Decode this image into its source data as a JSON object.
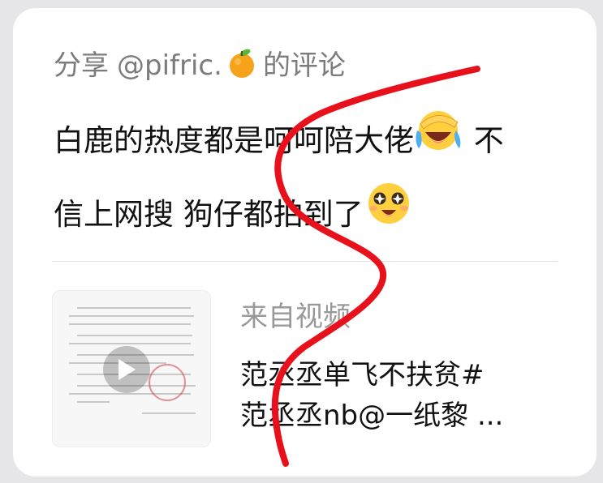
{
  "header": {
    "prefix": "分享",
    "handle": "@pifric.",
    "handle_emoji": "orange-emoji",
    "suffix": "的评论"
  },
  "comment": {
    "line1": "白鹿的热度都是呵呵陪大佬",
    "line1_emoji": "laughing-crying-emoji",
    "line1_tail": "不",
    "line2": "信上网搜 狗仔都拍到了",
    "line2_emoji": "starry-eyes-emoji"
  },
  "shared": {
    "source_label": "来自视频",
    "title_line1": "范丞丞单飞不扶贫#",
    "title_line2": "范丞丞nb@一纸黎 ...",
    "thumbnail_icon": "play-icon"
  },
  "colors": {
    "background": "#e6e6e8",
    "card": "#ffffff",
    "scribble": "#e8101a",
    "header_text": "#7c7c7c",
    "muted_text": "#999999"
  }
}
